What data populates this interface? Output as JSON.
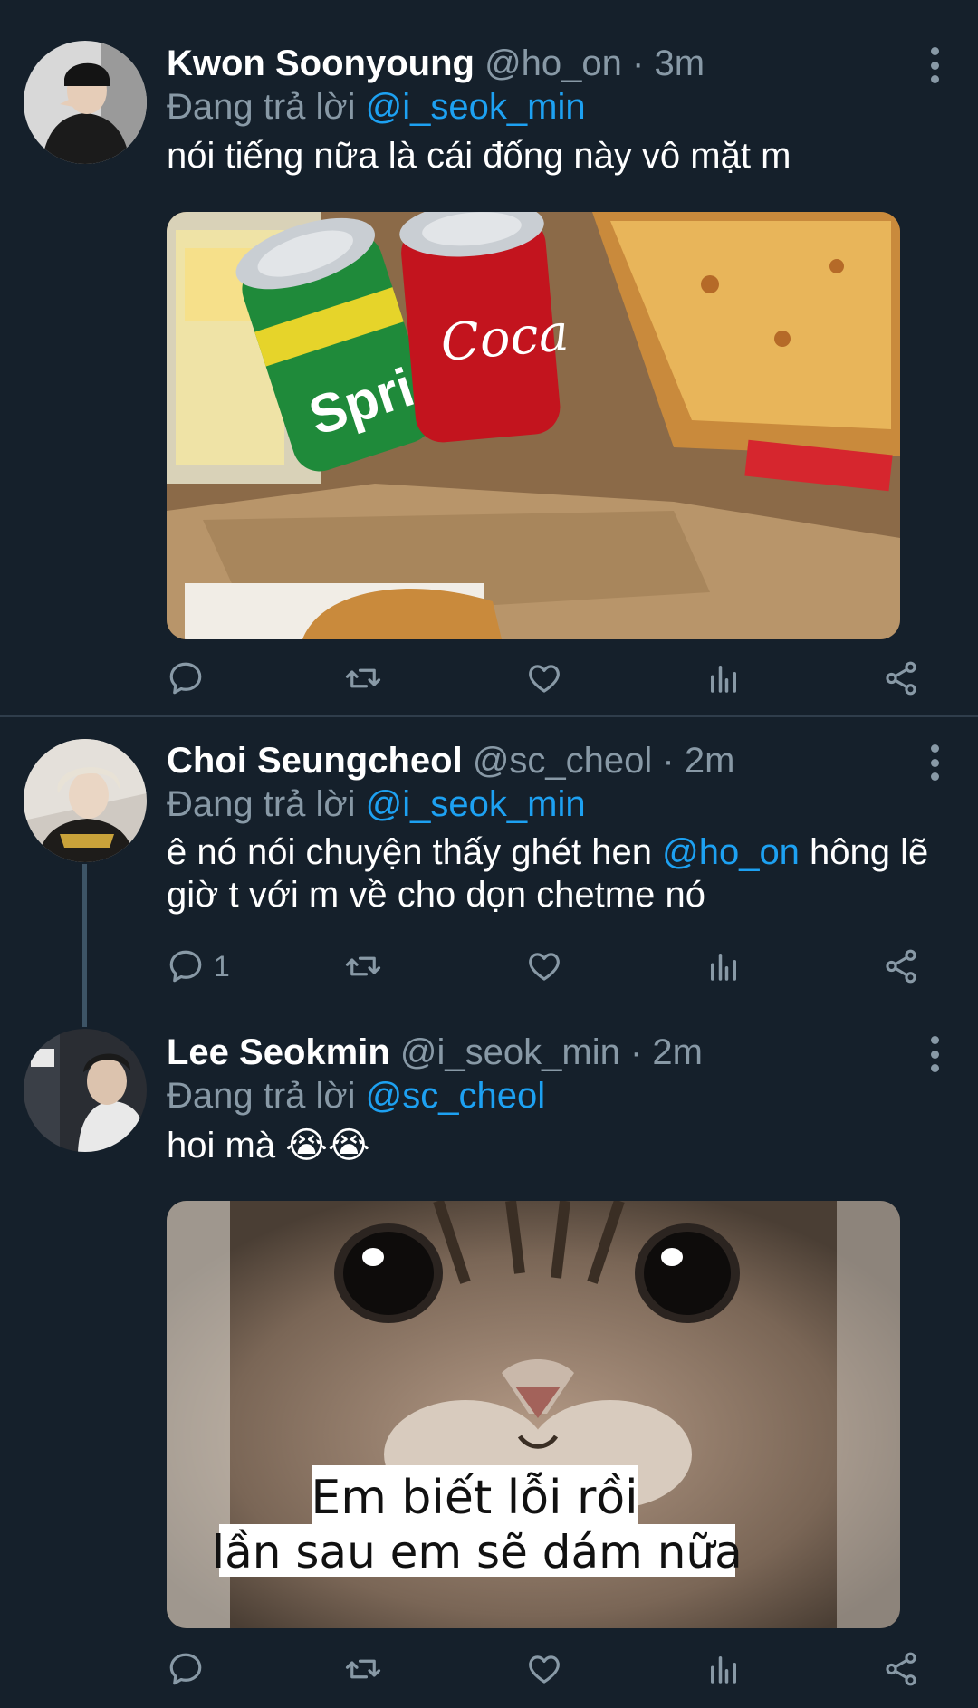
{
  "tweets": [
    {
      "name": "Kwon Soonyoung",
      "handle": "@ho_on",
      "sep": "·",
      "time": "3m",
      "reply_prefix": "Đang trả lời",
      "reply_to": "@i_seok_min",
      "text": "nói tiếng nữa là cái đống này vô mặt m",
      "media": {
        "can_labels": [
          "Spri",
          "Coca"
        ]
      },
      "actions": {
        "reply_count": "",
        "retweet_count": "",
        "like_count": ""
      }
    },
    {
      "name": "Choi Seungcheol",
      "handle": "@sc_cheol",
      "sep": "·",
      "time": "2m",
      "reply_prefix": "Đang trả lời",
      "reply_to": "@i_seok_min",
      "text_before": "ê nó nói chuyện thấy ghét hen ",
      "text_mention": "@ho_on",
      "text_after": " hông lẽ giờ t với m về cho dọn chetme nó",
      "actions": {
        "reply_count": "1",
        "retweet_count": "",
        "like_count": ""
      }
    },
    {
      "name": "Lee Seokmin",
      "handle": "@i_seok_min",
      "sep": "·",
      "time": "2m",
      "reply_prefix": "Đang trả lời",
      "reply_to": "@sc_cheol",
      "text": "hoi mà 😭😭",
      "media": {
        "caption_line1": "Em biết lỗi rồi",
        "caption_line2": "lần sau em sẽ dám nữa"
      },
      "actions": {
        "reply_count": "",
        "retweet_count": "",
        "like_count": ""
      }
    }
  ],
  "colors": {
    "background": "#15202b",
    "muted": "#8899a6",
    "mention": "#1da1f2"
  },
  "icons": [
    "reply-icon",
    "retweet-icon",
    "like-icon",
    "analytics-icon",
    "share-icon",
    "more-icon"
  ]
}
